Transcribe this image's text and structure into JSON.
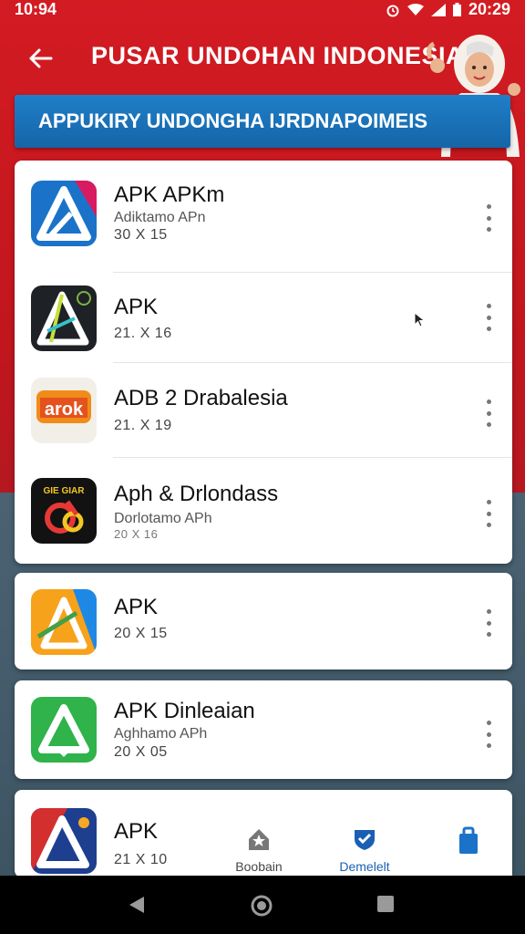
{
  "status": {
    "time": "10:94",
    "clock_right": "20:29"
  },
  "header": {
    "title": "PUSAR UNDOHAN INDONESIA"
  },
  "banner": {
    "text": "APPUKIRY UNDONGHA IJRDNAPOIMEIS"
  },
  "apps": [
    {
      "name": "APK APKm",
      "subtitle": "Adiktamo APn",
      "size": "30  X  15"
    },
    {
      "name": "APK",
      "subtitle": "",
      "size": "21.  X  16"
    },
    {
      "name": "ADB 2 Drabalesia",
      "subtitle": "",
      "size": "21.  X  19"
    },
    {
      "name": "Aph & Drlondass",
      "subtitle": "Dorlotamo APh",
      "size": "20  X  16"
    },
    {
      "name": "APK",
      "subtitle": "",
      "size": "20  X  15"
    },
    {
      "name": "APK Dinleaian",
      "subtitle": "Aghhamo APh",
      "size": "20  X  05"
    },
    {
      "name": "APK",
      "subtitle": "",
      "size": "21  X  10"
    }
  ],
  "icon_texts": {
    "app3": "arok",
    "app4": "GIE GIAR"
  },
  "bottom_nav": [
    {
      "label": "Boobain",
      "icon": "home-star-icon",
      "active": false
    },
    {
      "label": "Demelelt",
      "icon": "shield-check-icon",
      "active": true
    },
    {
      "label": "",
      "icon": "bag-icon",
      "active": false
    }
  ],
  "colors": {
    "brand_red": "#c4161c",
    "banner_blue": "#1f7fc8",
    "accent_blue": "#1a5fb4"
  }
}
